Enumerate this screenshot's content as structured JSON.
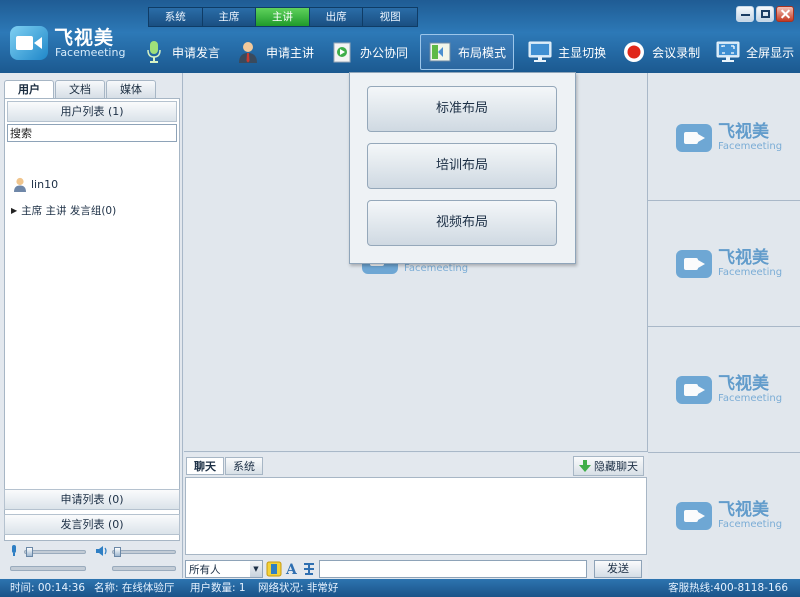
{
  "logo": {
    "title": "飞视美",
    "subtitle": "Facemeeting"
  },
  "menubar": [
    {
      "label": "系统",
      "active": false
    },
    {
      "label": "主席",
      "active": false
    },
    {
      "label": "主讲",
      "active": true
    },
    {
      "label": "出席",
      "active": false
    },
    {
      "label": "视图",
      "active": false
    }
  ],
  "toolbar": {
    "apply_speak": "申请发言",
    "apply_presenter": "申请主讲",
    "office_collab": "办公协同",
    "layout_mode": "布局模式",
    "main_display": "主显切换",
    "record": "会议录制",
    "fullscreen": "全屏显示"
  },
  "layout_menu": {
    "standard": "标准布局",
    "training": "培训布局",
    "video": "视频布局"
  },
  "left_panel": {
    "tabs": [
      {
        "label": "用户",
        "active": true
      },
      {
        "label": "文档",
        "active": false
      },
      {
        "label": "媒体",
        "active": false
      }
    ],
    "user_list_header": "用户列表 (1)",
    "search_value": "搜索",
    "users": [
      {
        "name": "lin10"
      }
    ],
    "group_label": "主席 主讲 发言组(0)",
    "apply_list": "申请列表 (0)",
    "speak_list": "发言列表 (0)"
  },
  "audio": {
    "mic_level": 0.02,
    "speaker_level": 0.02
  },
  "video_watermark": {
    "title": "飞视美",
    "subtitle": "Facemeeting"
  },
  "chat": {
    "tabs": [
      {
        "label": "聊天",
        "active": true
      },
      {
        "label": "系统",
        "active": false
      }
    ],
    "hide_label": "隐藏聊天",
    "recipient": "所有人",
    "message": "",
    "send_label": "发送"
  },
  "status": {
    "time": "时间: 00:14:36",
    "name": "名称: 在线体验厅",
    "user_count": "用户数量: 1",
    "network": "网络状况: 非常好",
    "hotline": "客服热线:400-8118-166"
  },
  "colors": {
    "accent": "#2d79b7",
    "active_tab": "#1f9a2a",
    "record": "#e0271a"
  }
}
